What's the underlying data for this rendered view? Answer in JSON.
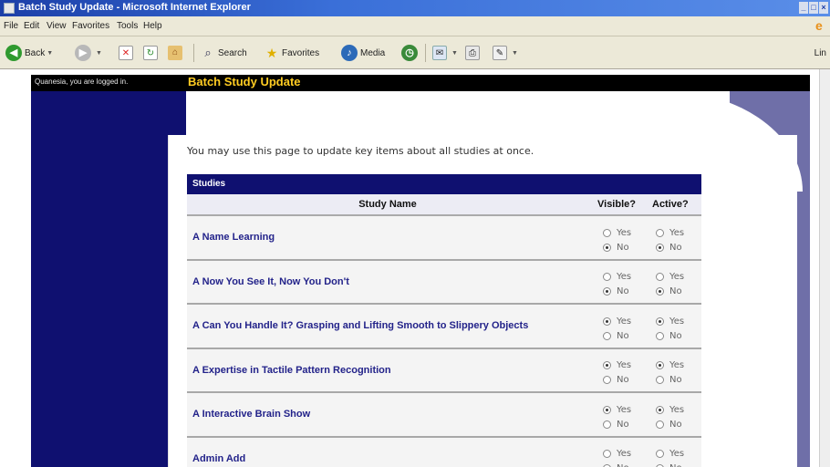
{
  "window": {
    "title": "Batch Study Update - Microsoft Internet Explorer",
    "buttons": [
      "_",
      "□",
      "×"
    ]
  },
  "menu": {
    "items": [
      "File",
      "Edit",
      "View",
      "Favorites",
      "Tools",
      "Help"
    ]
  },
  "toolbar": {
    "back": "Back",
    "search": "Search",
    "favorites": "Favorites",
    "media": "Media",
    "links": "Lin"
  },
  "page": {
    "login_text": "Quanesia, you are logged in.",
    "title": "Batch Study Update",
    "intro": "You may use this page to update key items about all studies at once.",
    "table": {
      "caption": "Studies",
      "headers": {
        "name": "Study Name",
        "visible": "Visible?",
        "active": "Active?"
      },
      "yes": "Yes",
      "no": "No",
      "rows": [
        {
          "name": "A Name Learning",
          "visible": "No",
          "active": "No"
        },
        {
          "name": "A Now You See It, Now You Don't",
          "visible": "No",
          "active": "No"
        },
        {
          "name": "A Can You Handle It? Grasping and Lifting Smooth to Slippery Objects",
          "visible": "Yes",
          "active": "Yes"
        },
        {
          "name": "A Expertise in Tactile Pattern Recognition",
          "visible": "Yes",
          "active": "Yes"
        },
        {
          "name": "A Interactive Brain Show",
          "visible": "Yes",
          "active": "Yes"
        },
        {
          "name": "Admin Add",
          "visible": "",
          "active": ""
        }
      ]
    }
  }
}
